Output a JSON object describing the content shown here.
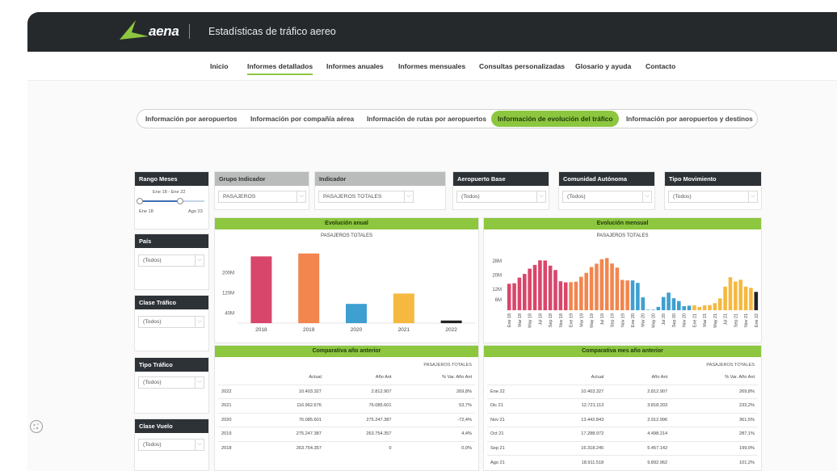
{
  "header": {
    "brand": "aena",
    "app_title": "Estadísticas de tráfico aereo"
  },
  "nav": {
    "items": [
      {
        "label": "Inicio"
      },
      {
        "label": "Informes detallados"
      },
      {
        "label": "Informes anuales"
      },
      {
        "label": "Informes mensuales"
      },
      {
        "label": "Consultas personalizadas"
      },
      {
        "label": "Glosario y ayuda"
      },
      {
        "label": "Contacto"
      }
    ],
    "active_index": 1
  },
  "subtabs": {
    "items": [
      {
        "label": "Información por aeropuertos"
      },
      {
        "label": "Información por compañía aérea"
      },
      {
        "label": "Información de rutas por aeropuertos"
      },
      {
        "label": "Información de evolución del tráfico"
      },
      {
        "label": "Información por aeropuertos y destinos"
      }
    ],
    "active_index": 3
  },
  "filters": {
    "rango_meses": {
      "title": "Rango Meses",
      "range_label": "Ene 18 - Ene 22",
      "min_label": "Ene 18",
      "max_label": "Ago 23"
    },
    "pais": {
      "title": "País",
      "value": "(Todos)"
    },
    "clase_trafico": {
      "title": "Clase Tráfico",
      "value": "(Todos)"
    },
    "tipo_trafico": {
      "title": "Tipo Tráfico",
      "value": "(Todos)"
    },
    "clase_vuelo": {
      "title": "Clase Vuelo",
      "value": "(Todos)"
    },
    "grupo_indicador": {
      "title": "Grupo Indicador",
      "value": "PASAJEROS"
    },
    "indicador": {
      "title": "Indicador",
      "value": "PASAJEROS TOTALES"
    },
    "aeropuerto_base": {
      "title": "Aeropuerto Base",
      "value": "(Todos)"
    },
    "comunidad_autonoma": {
      "title": "Comunidad Autónoma",
      "value": "(Todos)"
    },
    "tipo_movimiento": {
      "title": "Tipo Movimiento",
      "value": "(Todos)"
    }
  },
  "colors": {
    "brand_green": "#8dc63f",
    "dark_header": "#2d3237",
    "y2018": "#d9466b",
    "y2019": "#f2864e",
    "y2020": "#3f9fd0",
    "y2021": "#f5b940",
    "y2022": "#222222"
  },
  "annual": {
    "title": "Evolución anual",
    "subtitle": "PASAJEROS TOTALES",
    "y_ticks": [
      "40M",
      "120M",
      "200M"
    ]
  },
  "monthly": {
    "title": "Evolución mensual",
    "subtitle": "PASAJEROS TOTALES",
    "y_ticks": [
      "6M",
      "12M",
      "20M",
      "28M"
    ]
  },
  "chart_data": [
    {
      "type": "bar",
      "title": "Evolución anual",
      "subtitle": "PASAJEROS TOTALES",
      "categories": [
        "2018",
        "2019",
        "2020",
        "2021",
        "2022"
      ],
      "values": [
        263754357,
        275247387,
        76085601,
        116962676,
        10403327
      ],
      "colors": [
        "#d9466b",
        "#f2864e",
        "#3f9fd0",
        "#f5b940",
        "#222222"
      ],
      "y_ticks": [
        40000000,
        120000000,
        200000000
      ],
      "ylim": [
        0,
        300000000
      ],
      "grid": false
    },
    {
      "type": "bar",
      "title": "Evolución mensual",
      "subtitle": "PASAJEROS TOTALES",
      "categories": [
        "Ene 18",
        "Feb 18",
        "Mar 18",
        "Abr 18",
        "May 18",
        "Jun 18",
        "Jul 18",
        "Ago 18",
        "Sep 18",
        "Oct 18",
        "Nov 18",
        "Dic 18",
        "Ene 19",
        "Feb 19",
        "Mar 19",
        "Abr 19",
        "May 19",
        "Jun 19",
        "Jul 19",
        "Ago 19",
        "Sep 19",
        "Oct 19",
        "Nov 19",
        "Dic 19",
        "Ene 20",
        "Feb 20",
        "Mar 20",
        "Abr 20",
        "May 20",
        "Jun 20",
        "Jul 20",
        "Ago 20",
        "Sep 20",
        "Oct 20",
        "Nov 20",
        "Dic 20",
        "Ene 21",
        "Feb 21",
        "Mar 21",
        "Abr 21",
        "May 21",
        "Jun 21",
        "Jul 21",
        "Ago 21",
        "Sep 21",
        "Oct 21",
        "Nov 21",
        "Dic 21",
        "Ene 22"
      ],
      "tick_labels": [
        "Ene 18",
        "Mar 18",
        "May 18",
        "Jul 18",
        "Sep 18",
        "Nov 18",
        "Ene 19",
        "Mar 19",
        "May 19",
        "Jul 19",
        "Sep 19",
        "Nov 19",
        "Ene 20",
        "Mar 20",
        "May 20",
        "Jul 20",
        "Sep 20",
        "Nov 20",
        "Ene 21",
        "Mar 21",
        "May 21",
        "Jul 21",
        "Sep 21",
        "Nov 21",
        "Ene 22"
      ],
      "values": [
        15.0,
        15.3,
        18.5,
        20.6,
        23.6,
        25.7,
        28.3,
        28.2,
        25.3,
        22.8,
        16.4,
        15.8,
        15.9,
        16.2,
        19.0,
        21.2,
        24.5,
        26.4,
        28.9,
        29.6,
        26.5,
        24.2,
        17.2,
        16.9,
        16.9,
        15.5,
        7.3,
        0.1,
        0.3,
        1.9,
        7.5,
        10.0,
        6.8,
        5.2,
        2.3,
        2.6,
        2.8,
        1.9,
        2.8,
        2.9,
        4.0,
        6.7,
        13.4,
        18.7,
        16.3,
        17.3,
        13.4,
        12.7,
        10.4
      ],
      "unit": "millones de pasajeros",
      "year_colors": [
        "#d9466b",
        "#f2864e",
        "#3f9fd0",
        "#f5b940",
        "#222222"
      ],
      "y_ticks": [
        6,
        12,
        20,
        28
      ],
      "ylim": [
        0,
        33
      ],
      "grid": false
    },
    {
      "type": "table",
      "title": "Comparativa año anterior",
      "subtitle": "PASAJEROS TOTALES",
      "columns": [
        "",
        "Actual",
        "Año Ant",
        "% Var. Año Ant"
      ],
      "rows": [
        [
          "2022",
          "10.403.327",
          "2.812.907",
          "269,8%"
        ],
        [
          "2021",
          "116.962.676",
          "76.085.601",
          "53,7%"
        ],
        [
          "2020",
          "76.085.601",
          "275.247.387",
          "-72,4%"
        ],
        [
          "2019",
          "275.247.387",
          "263.754.357",
          "4,4%"
        ],
        [
          "2018",
          "263.754.357",
          "0",
          "0,0%"
        ]
      ]
    },
    {
      "type": "table",
      "title": "Comparativa mes año anterior",
      "subtitle": "PASAJEROS TOTALES",
      "columns": [
        "",
        "Actual",
        "Año Ant",
        "% Var. Año Ant"
      ],
      "rows": [
        [
          "Ene 22",
          "10.403.327",
          "2.812.907",
          "269,8%"
        ],
        [
          "Dic 21",
          "12.721.113",
          "3.818.203",
          "233,2%"
        ],
        [
          "Nov 21",
          "13.442.843",
          "2.912.996",
          "361,5%"
        ],
        [
          "Oct 21",
          "17.288.972",
          "4.498.214",
          "287,1%"
        ],
        [
          "Sep 21",
          "16.318.245",
          "5.457.142",
          "199,0%"
        ],
        [
          "Ago 21",
          "18.911.518",
          "9.892.962",
          "101,2%"
        ]
      ]
    }
  ]
}
